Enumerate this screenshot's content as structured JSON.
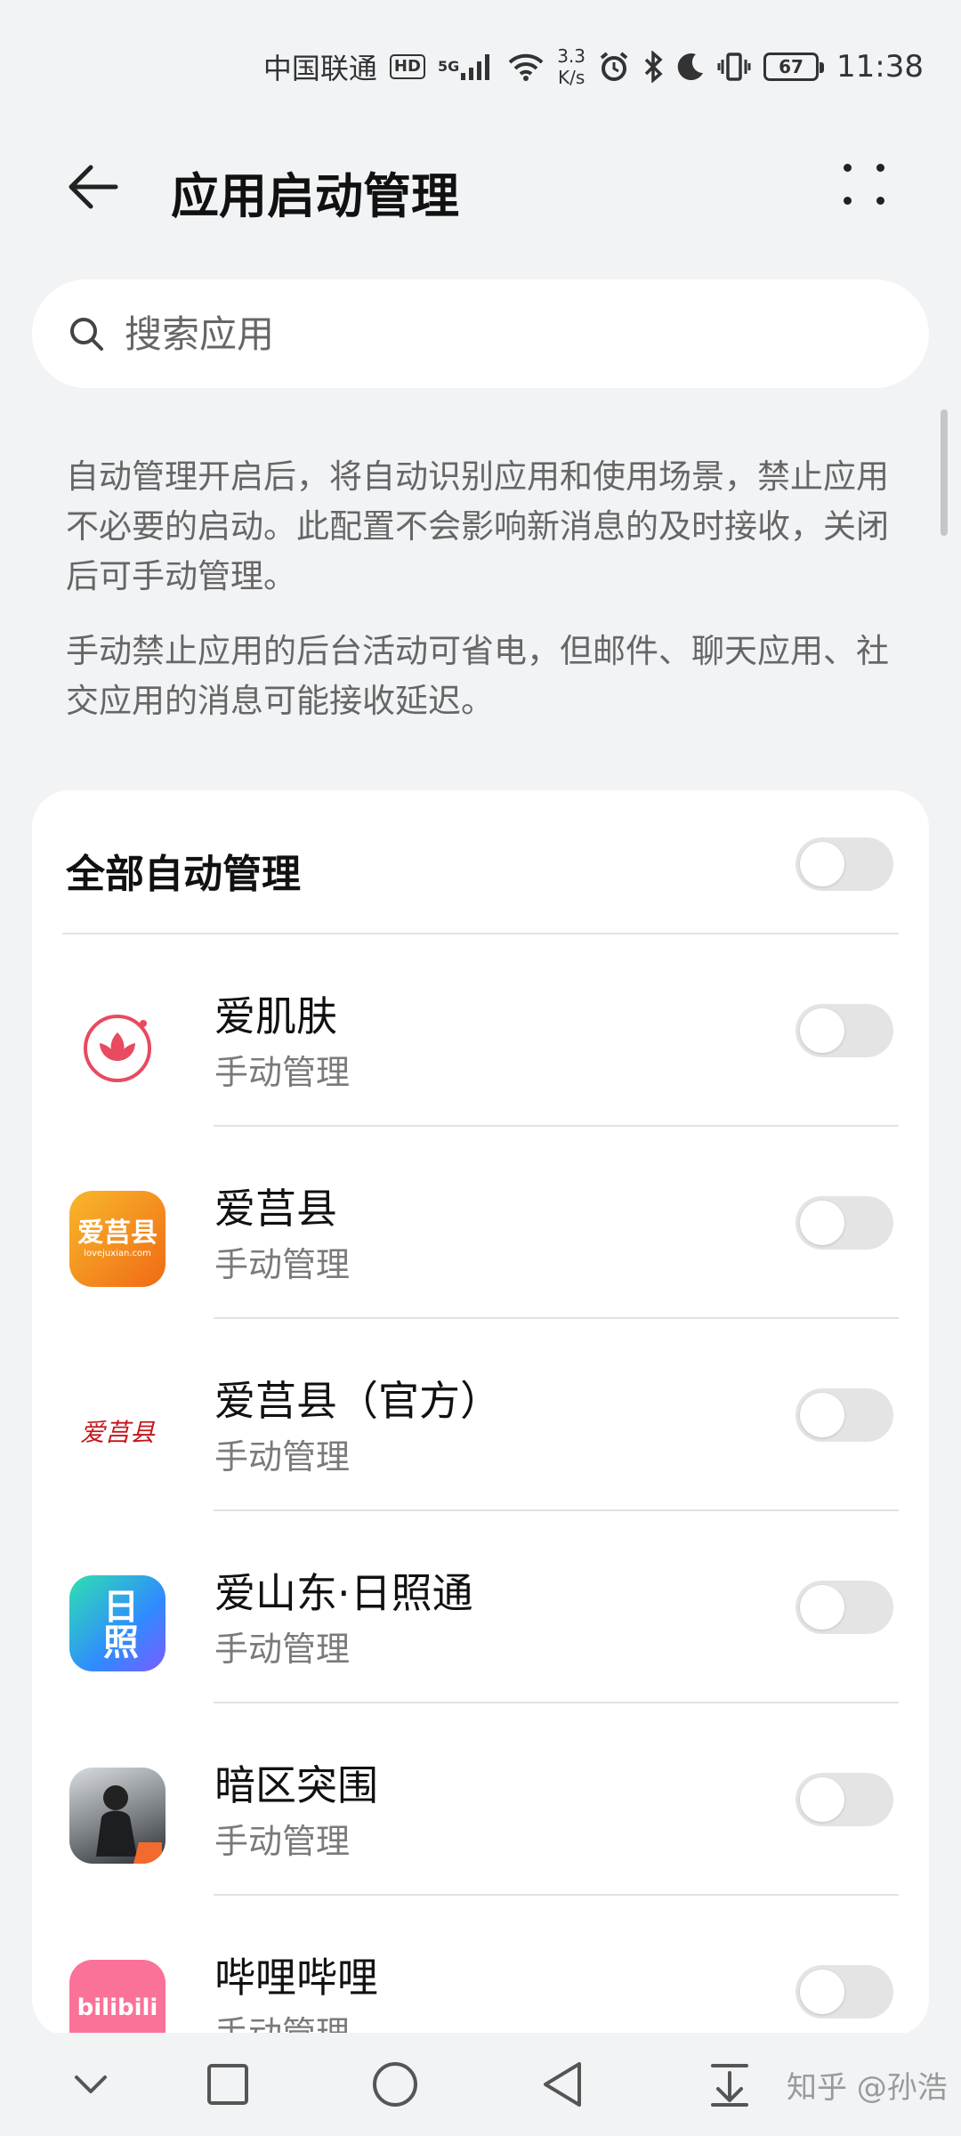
{
  "status_bar": {
    "carrier": "中国联通",
    "hd_badge": "HD",
    "network_type": "5G",
    "speed_value": "3.3",
    "speed_unit": "K/s",
    "battery": "67",
    "time": "11:38"
  },
  "header": {
    "title": "应用启动管理"
  },
  "search": {
    "placeholder": "搜索应用"
  },
  "description": {
    "paragraph_1": "自动管理开启后，将自动识别应用和使用场景，禁止应用不必要的启动。此配置不会影响新消息的及时接收，关闭后可手动管理。",
    "paragraph_2": "手动禁止应用的后台活动可省电，但邮件、聊天应用、社交应用的消息可能接收延迟。"
  },
  "list": {
    "all_auto_label": "全部自动管理",
    "all_auto_enabled": false,
    "apps": [
      {
        "name": "爱肌肤",
        "status": "手动管理",
        "enabled": false
      },
      {
        "name": "爱莒县",
        "status": "手动管理",
        "enabled": false
      },
      {
        "name": "爱莒县（官方）",
        "status": "手动管理",
        "enabled": false
      },
      {
        "name": "爱山东·日照通",
        "status": "手动管理",
        "enabled": false
      },
      {
        "name": "暗区突围",
        "status": "手动管理",
        "enabled": false
      },
      {
        "name": "哔哩哔哩",
        "status": "手动管理",
        "enabled": false
      }
    ]
  },
  "icon_text": {
    "aijuxian": "爱莒县",
    "aijuxian_url": "lovejuxian.com",
    "aijuxian_official": "爱莒县",
    "rizhao": "日照",
    "bilibili": "bilibili"
  },
  "watermark": "知乎 @孙浩",
  "colors": {
    "background": "#f1f3f5",
    "card": "#ffffff",
    "toggle_off": "#e4e4e4",
    "secondary_text": "#666666"
  }
}
